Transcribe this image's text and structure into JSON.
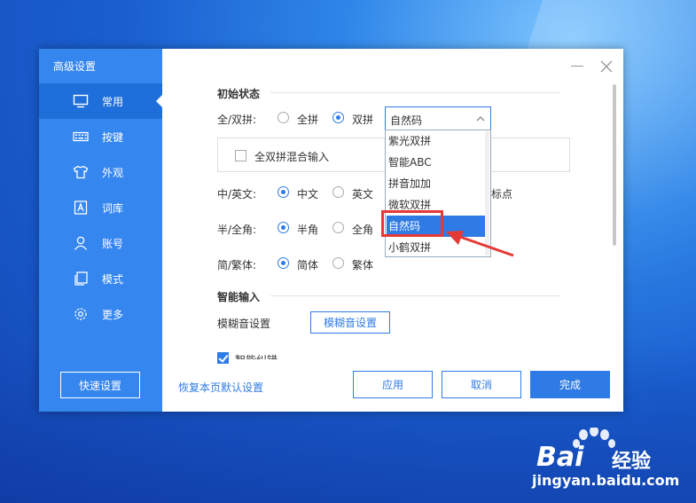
{
  "sidebar": {
    "title": "高级设置",
    "items": [
      {
        "label": "常用",
        "icon": "monitor-icon",
        "active": true
      },
      {
        "label": "按键",
        "icon": "keyboard-icon",
        "active": false
      },
      {
        "label": "外观",
        "icon": "tshirt-icon",
        "active": false
      },
      {
        "label": "词库",
        "icon": "lexicon-icon",
        "active": false
      },
      {
        "label": "账号",
        "icon": "user-icon",
        "active": false
      },
      {
        "label": "模式",
        "icon": "copy-icon",
        "active": false
      },
      {
        "label": "更多",
        "icon": "gear-icon",
        "active": false
      }
    ],
    "quick_setup": "快速设置"
  },
  "initial": {
    "section_title": "初始状态",
    "pinyin": {
      "label": "全/双拼:",
      "opt1": "全拼",
      "opt2": "双拼",
      "selected": "双拼"
    },
    "scheme": {
      "value": "自然码",
      "options": [
        "紫光双拼",
        "智能ABC",
        "拼音加加",
        "微软双拼",
        "自然码",
        "小鹤双拼"
      ],
      "selected_index": 4
    },
    "mixed_label": "全双拼混合输入",
    "cn_en": {
      "label": "中/英文:",
      "opt1": "中文",
      "opt2": "英文",
      "selected": "中文",
      "trailing": "标点"
    },
    "width": {
      "label": "半/全角:",
      "opt1": "半角",
      "opt2": "全角",
      "selected": "半角"
    },
    "script": {
      "label": "简/繁体:",
      "opt1": "简体",
      "opt2": "繁体",
      "selected": "简体"
    }
  },
  "smart": {
    "section_title": "智能输入",
    "fuzzy_label": "模糊音设置",
    "fuzzy_button": "模糊音设置",
    "partial_label": "智能纠错"
  },
  "footer": {
    "restore_link": "恢复本页默认设置",
    "apply": "应用",
    "cancel": "取消",
    "done": "完成"
  },
  "watermark": {
    "brand": "Bai",
    "brand2": "经验",
    "url": "jingyan.baidu.com"
  },
  "colors": {
    "accent": "#2f7be5",
    "sidebar": "#3586ef",
    "annotation": "#e53935"
  }
}
